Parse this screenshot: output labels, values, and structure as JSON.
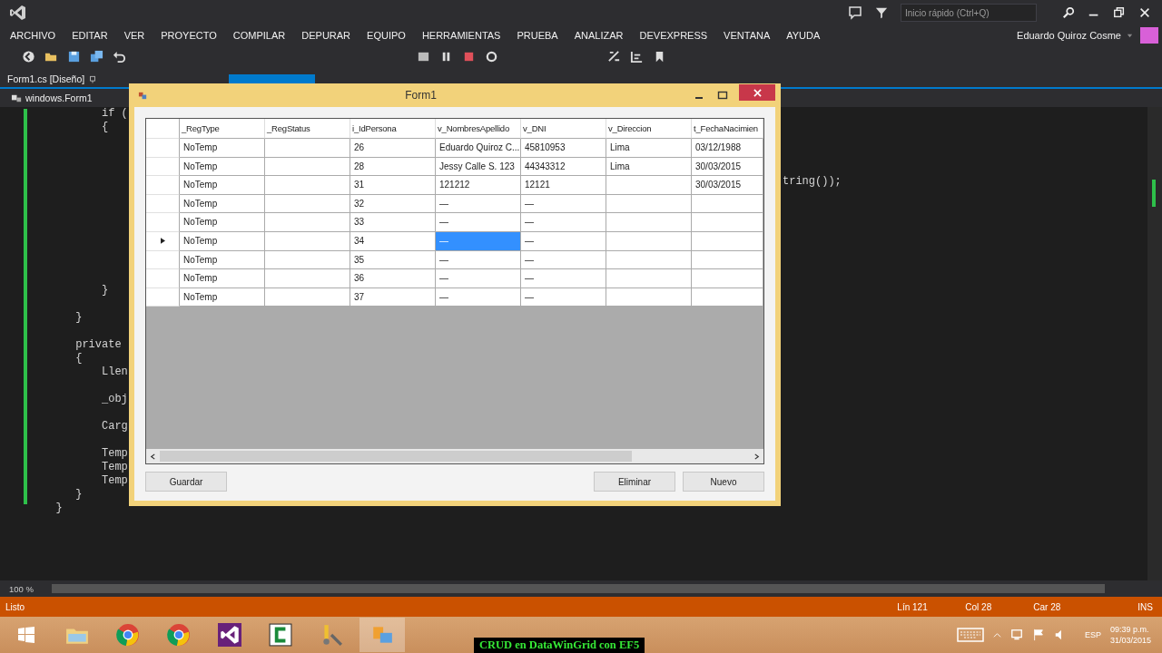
{
  "ide": {
    "quick_launch": {
      "placeholder": "Inicio rápido (Ctrl+Q)"
    },
    "menu": [
      "ARCHIVO",
      "EDITAR",
      "VER",
      "PROYECTO",
      "COMPILAR",
      "DEPURAR",
      "EQUIPO",
      "HERRAMIENTAS",
      "PRUEBA",
      "ANALIZAR",
      "DEVEXPRESS",
      "VENTANA",
      "AYUDA"
    ],
    "user": "Eduardo Quiroz Cosme",
    "document_tab": {
      "label": "Form1.cs [Diseño]"
    },
    "navigation": "windows.Form1",
    "code_lines": [
      {
        "kind": "code",
        "text": "          if ("
      },
      {
        "kind": "code",
        "text": "          {"
      },
      {
        "kind": "blank"
      },
      {
        "kind": "blank"
      },
      {
        "kind": "blank"
      },
      {
        "kind": "blank",
        "tail": "tring());"
      },
      {
        "kind": "blank"
      },
      {
        "kind": "blank"
      },
      {
        "kind": "blank"
      },
      {
        "kind": "blank"
      },
      {
        "kind": "blank"
      },
      {
        "kind": "blank"
      },
      {
        "kind": "blank"
      },
      {
        "kind": "code",
        "text": "          }"
      },
      {
        "kind": "blank"
      },
      {
        "kind": "code",
        "text": "      }"
      },
      {
        "kind": "blank"
      },
      {
        "kind": "code",
        "text": "      private"
      },
      {
        "kind": "code",
        "text": "      {"
      },
      {
        "kind": "code",
        "text": "          Llen"
      },
      {
        "kind": "blank"
      },
      {
        "kind": "code",
        "text": "          _obj"
      },
      {
        "kind": "blank"
      },
      {
        "kind": "code",
        "text": "          Carg"
      },
      {
        "kind": "blank"
      },
      {
        "kind": "code",
        "text": "          Temp"
      },
      {
        "kind": "code",
        "text": "          Temp"
      },
      {
        "kind": "code",
        "text": "          Temp"
      },
      {
        "kind": "code",
        "text": "      }"
      },
      {
        "kind": "code",
        "text": "   }"
      }
    ],
    "zoom": "100 %",
    "status_bar": {
      "state": "Listo",
      "line": "Lín 121",
      "column": "Col 28",
      "char": "Car 28",
      "mode": "INS"
    }
  },
  "form": {
    "title": "Form1",
    "columns": [
      "_RegType",
      "_RegStatus",
      "i_IdPersona",
      "v_NombresApellido",
      "v_DNI",
      "v_Direccion",
      "t_FechaNacimien"
    ],
    "rows": [
      {
        "current": false,
        "cells": [
          {
            "text": "NoTemp",
            "selected": false
          },
          {
            "selected": false
          },
          {
            "text": "26",
            "selected": false
          },
          {
            "text": "Eduardo Quiroz C...",
            "selected": false
          },
          {
            "text": "45810953",
            "selected": false
          },
          {
            "text": "Lima",
            "selected": false
          },
          {
            "text": "03/12/1988",
            "selected": false
          }
        ]
      },
      {
        "current": false,
        "cells": [
          {
            "text": "NoTemp",
            "selected": false
          },
          {
            "selected": false
          },
          {
            "text": "28",
            "selected": false
          },
          {
            "text": "Jessy Calle S. 123",
            "selected": false
          },
          {
            "text": "44343312",
            "selected": false
          },
          {
            "text": "Lima",
            "selected": false
          },
          {
            "text": "30/03/2015",
            "selected": false
          }
        ]
      },
      {
        "current": false,
        "cells": [
          {
            "text": "NoTemp",
            "selected": false
          },
          {
            "selected": false
          },
          {
            "text": "31",
            "selected": false
          },
          {
            "text": "121212",
            "selected": false
          },
          {
            "text": "12121",
            "selected": false
          },
          {
            "selected": false
          },
          {
            "text": "30/03/2015",
            "selected": false
          }
        ]
      },
      {
        "current": false,
        "cells": [
          {
            "text": "NoTemp",
            "selected": false
          },
          {
            "selected": false
          },
          {
            "text": "32",
            "selected": false
          },
          {
            "text": "—",
            "selected": false
          },
          {
            "text": "—",
            "selected": false
          },
          {
            "selected": false
          },
          {
            "selected": false
          }
        ]
      },
      {
        "current": false,
        "cells": [
          {
            "text": "NoTemp",
            "selected": false
          },
          {
            "selected": false
          },
          {
            "text": "33",
            "selected": false
          },
          {
            "text": "—",
            "selected": false
          },
          {
            "text": "—",
            "selected": false
          },
          {
            "selected": false
          },
          {
            "selected": false
          }
        ]
      },
      {
        "current": true,
        "cells": [
          {
            "text": "NoTemp",
            "selected": false
          },
          {
            "selected": false
          },
          {
            "text": "34",
            "selected": false
          },
          {
            "text": "—",
            "selected": true
          },
          {
            "text": "—",
            "selected": false
          },
          {
            "selected": false
          },
          {
            "selected": false
          }
        ]
      },
      {
        "current": false,
        "cells": [
          {
            "text": "NoTemp",
            "selected": false
          },
          {
            "selected": false
          },
          {
            "text": "35",
            "selected": false
          },
          {
            "text": "—",
            "selected": false
          },
          {
            "text": "—",
            "selected": false
          },
          {
            "selected": false
          },
          {
            "selected": false
          }
        ]
      },
      {
        "current": false,
        "cells": [
          {
            "text": "NoTemp",
            "selected": false
          },
          {
            "selected": false
          },
          {
            "text": "36",
            "selected": false
          },
          {
            "text": "—",
            "selected": false
          },
          {
            "text": "—",
            "selected": false
          },
          {
            "selected": false
          },
          {
            "selected": false
          }
        ]
      },
      {
        "current": false,
        "cells": [
          {
            "text": "NoTemp",
            "selected": false
          },
          {
            "selected": false
          },
          {
            "text": "37",
            "selected": false
          },
          {
            "text": "—",
            "selected": false
          },
          {
            "text": "—",
            "selected": false
          },
          {
            "selected": false
          },
          {
            "selected": false
          }
        ]
      }
    ],
    "buttons": [
      "Guardar",
      "Eliminar",
      "Nuevo"
    ]
  },
  "taskbar": {
    "caption": "CRUD en DataWinGrid con EF5",
    "language": "ESP",
    "time": "09:39 p.m.",
    "date": "31/03/2015"
  }
}
